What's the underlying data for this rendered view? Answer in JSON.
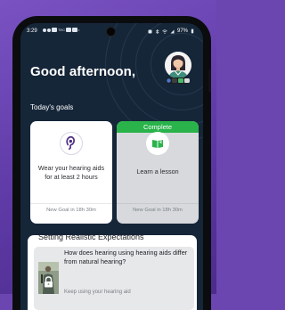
{
  "status_bar": {
    "time": "3:29",
    "notification_text": "TEC",
    "battery": "97%"
  },
  "header": {
    "greeting": "Good afternoon,"
  },
  "goals": {
    "section_title": "Today's goals",
    "cards": [
      {
        "text": "Wear your hearing aids for at least 2 hours",
        "footer": "New Goal in 18h 30m",
        "icon": "hearing-aid-icon",
        "completed": false
      },
      {
        "badge": "Complete",
        "text": "Learn a lesson",
        "footer": "New Goal in 18h 30m",
        "icon": "book-icon",
        "completed": true
      }
    ]
  },
  "expectations": {
    "section_title": "Setting Realistic Expectations",
    "article": {
      "title": "How does hearing using hearing aids differ from natural hearing?",
      "description": "Keep using your hearing aid",
      "thumbnail_icon": "lock-icon"
    }
  },
  "colors": {
    "background": "#6b45b0",
    "screen": "#162639",
    "complete_green": "#29b34a",
    "icon_purple": "#4f2f85"
  }
}
